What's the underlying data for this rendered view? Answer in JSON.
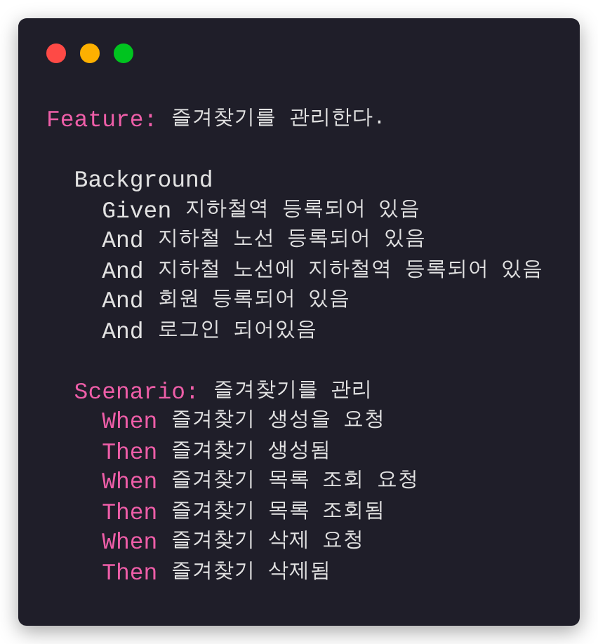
{
  "window_controls": [
    {
      "color": "#fe4a46"
    },
    {
      "color": "#fdb000"
    },
    {
      "color": "#00c41f"
    }
  ],
  "feature": {
    "keyword": "Feature:",
    "text": "즐겨찾기를 관리한다.",
    "background": {
      "title": "Background",
      "steps": [
        {
          "keyword": "Given",
          "text": "지하철역 등록되어 있음"
        },
        {
          "keyword": "And",
          "text": "지하철 노선 등록되어 있음"
        },
        {
          "keyword": "And",
          "text": "지하철 노선에 지하철역 등록되어 있음"
        },
        {
          "keyword": "And",
          "text": "회원 등록되어 있음"
        },
        {
          "keyword": "And",
          "text": "로그인 되어있음"
        }
      ]
    },
    "scenario": {
      "keyword": "Scenario:",
      "text": "즐겨찾기를 관리",
      "steps": [
        {
          "keyword": "When",
          "text": "즐겨찾기 생성을 요청"
        },
        {
          "keyword": "Then",
          "text": "즐겨찾기 생성됨"
        },
        {
          "keyword": "When",
          "text": "즐겨찾기 목록 조회 요청"
        },
        {
          "keyword": "Then",
          "text": "즐겨찾기 목록 조회됨"
        },
        {
          "keyword": "When",
          "text": "즐겨찾기 삭제 요청"
        },
        {
          "keyword": "Then",
          "text": "즐겨찾기 삭제됨"
        }
      ]
    }
  }
}
